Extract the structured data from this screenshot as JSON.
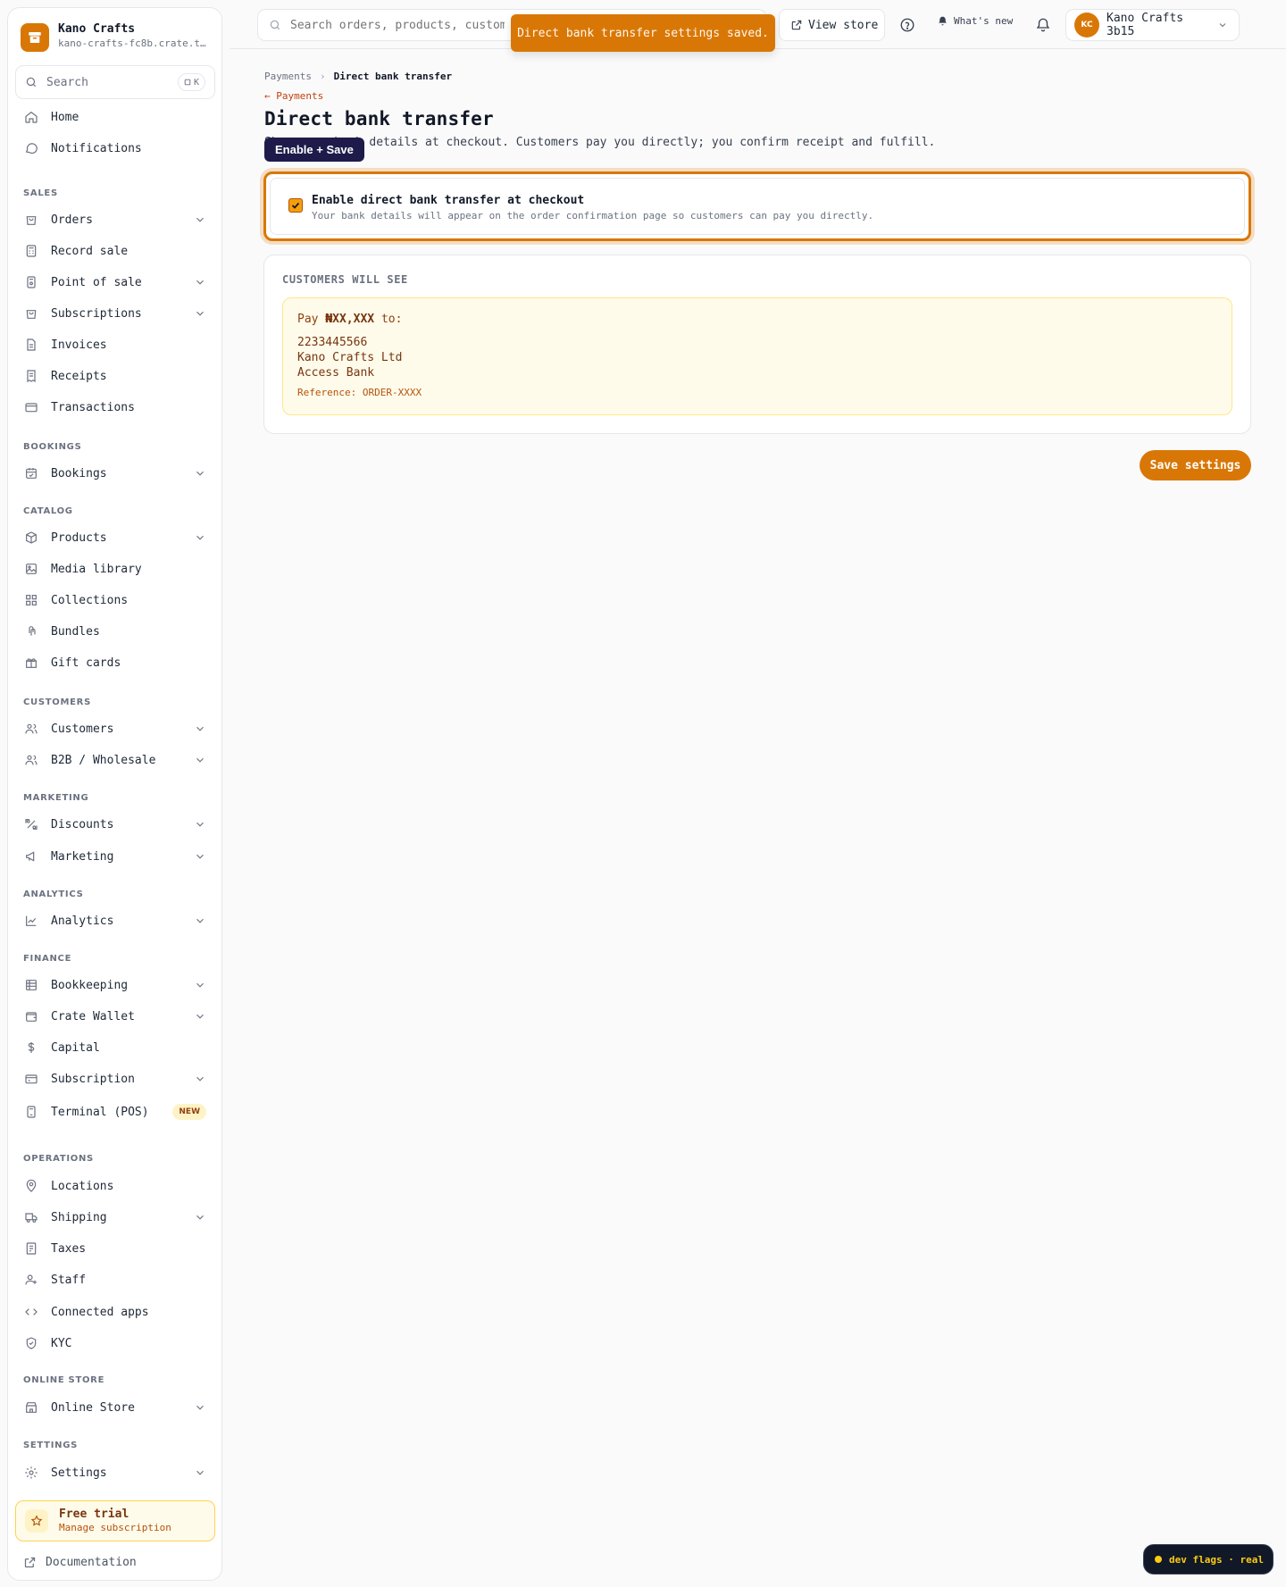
{
  "brand": {
    "name": "Kano Crafts",
    "subdomain": "kano-crafts-fc8b.crate.t…",
    "accent_color": "#d97706"
  },
  "sidebar": {
    "search_label": "Search",
    "search_shortcut": "K",
    "top_items": [
      {
        "label": "Home",
        "icon": "home-icon"
      },
      {
        "label": "Notifications",
        "icon": "chat-bubble-icon"
      }
    ],
    "sections": {
      "sales": "SALES",
      "bookings": "BOOKINGS",
      "catalog": "CATALOG",
      "customers": "CUSTOMERS",
      "marketing": "MARKETING",
      "analytics": "ANALYTICS",
      "finance": "FINANCE",
      "operations": "OPERATIONS",
      "online_store": "ONLINE STORE",
      "settings": "SETTINGS"
    },
    "items": {
      "orders": "Orders",
      "record_sale": "Record sale",
      "pos": "Point of sale",
      "subscriptions": "Subscriptions",
      "invoices": "Invoices",
      "receipts": "Receipts",
      "transactions": "Transactions",
      "bookings": "Bookings",
      "products": "Products",
      "media_library": "Media library",
      "collections": "Collections",
      "bundles": "Bundles",
      "gift_cards": "Gift cards",
      "customers": "Customers",
      "b2b": "B2B / Wholesale",
      "discounts": "Discounts",
      "marketing": "Marketing",
      "analytics": "Analytics",
      "bookkeeping": "Bookkeeping",
      "crate_wallet": "Crate Wallet",
      "capital": "Capital",
      "subscription": "Subscription",
      "terminal": "Terminal (POS)",
      "terminal_badge": "NEW",
      "locations": "Locations",
      "shipping": "Shipping",
      "taxes": "Taxes",
      "staff": "Staff",
      "connected_apps": "Connected apps",
      "kyc": "KYC",
      "online_store": "Online Store",
      "settings": "Settings"
    },
    "trial": {
      "title": "Free trial",
      "subtitle": "Manage subscription"
    },
    "documentation": "Documentation"
  },
  "header": {
    "search_placeholder": "Search orders, products, customers…",
    "toast": "Direct bank transfer settings saved.",
    "view_store": "View store",
    "whats_new": "What's new",
    "account_initials": "KC",
    "account_name": "Kano Crafts 3b15"
  },
  "main": {
    "breadcrumb": {
      "parent": "Payments",
      "current": "Direct bank transfer"
    },
    "back_link": "← Payments",
    "title": "Direct bank transfer",
    "description": "Show your bank details at checkout. Customers pay you directly; you confirm receipt and fulfill.",
    "tooltip": "Enable + Save",
    "enable": {
      "checked": true,
      "title": "Enable direct bank transfer at checkout",
      "description": "Your bank details will appear on the order confirmation page so customers can pay you directly."
    },
    "preview": {
      "heading": "CUSTOMERS WILL SEE",
      "pay_prefix": "Pay",
      "pay_amount": "₦XX,XXX",
      "pay_suffix": "to:",
      "account_number": "2233445566",
      "account_name": "Kano Crafts Ltd",
      "bank_name": "Access Bank",
      "reference": "Reference: ORDER-XXXX"
    },
    "save_button": "Save settings"
  },
  "dev_flags": "dev flags · real"
}
